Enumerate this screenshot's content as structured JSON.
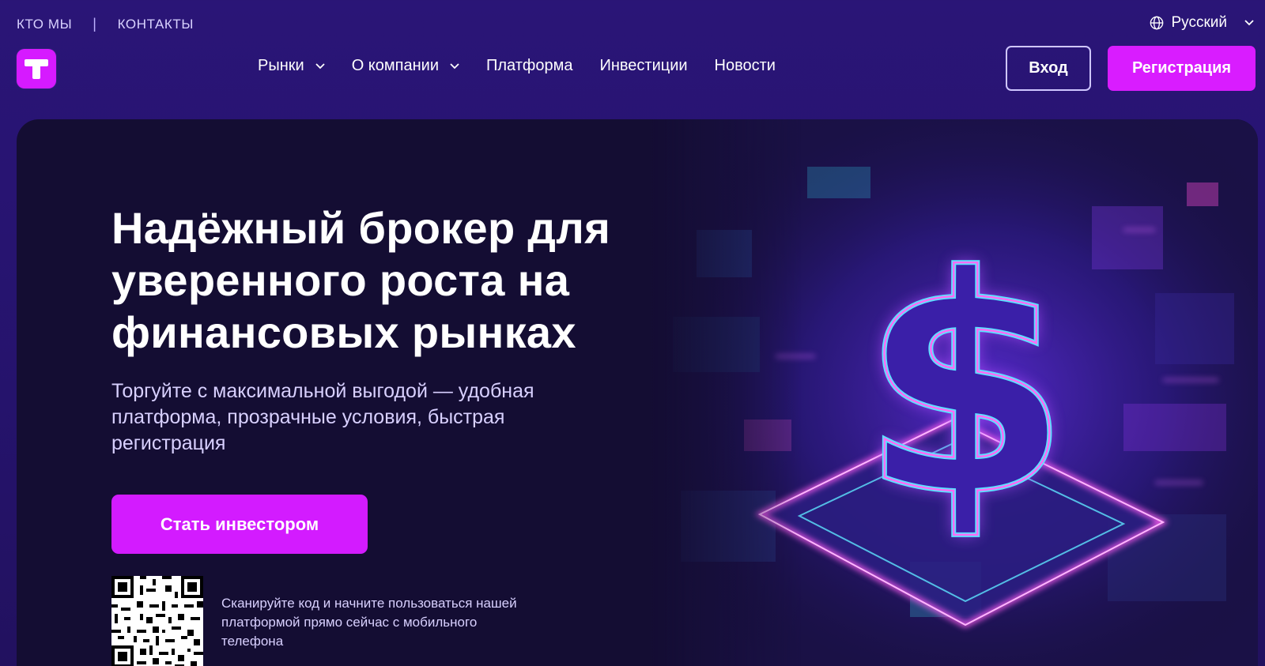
{
  "topbar": {
    "links": [
      "КТО МЫ",
      "КОНТАКТЫ"
    ],
    "separator": "|",
    "language": "Русский"
  },
  "nav": {
    "items": [
      {
        "label": "Рынки",
        "dropdown": true
      },
      {
        "label": "О компании",
        "dropdown": true
      },
      {
        "label": "Платформа",
        "dropdown": false
      },
      {
        "label": "Инвестиции",
        "dropdown": false
      },
      {
        "label": "Новости",
        "dropdown": false
      }
    ],
    "login_label": "Вход",
    "register_label": "Регистрация"
  },
  "hero": {
    "title": "Надёжный брокер для уверенного роста на финансовых рынках",
    "subtitle": "Торгуйте с максимальной выгодой — удобная платформа, прозрачные условия, быстрая регистрация",
    "cta_label": "Стать инвестором",
    "qr_caption": "Сканируйте код и начните пользоваться нашей платформой прямо сейчас с мобильного телефона",
    "illustration": "neon-dollar-sign-circuit-board"
  },
  "colors": {
    "page_bg": "#281474",
    "hero_bg": "#140d33",
    "accent": "#d91cff"
  },
  "icons": {
    "logo": "logo-t-icon",
    "language": "globe-icon",
    "dropdown": "chevron-down-icon"
  }
}
